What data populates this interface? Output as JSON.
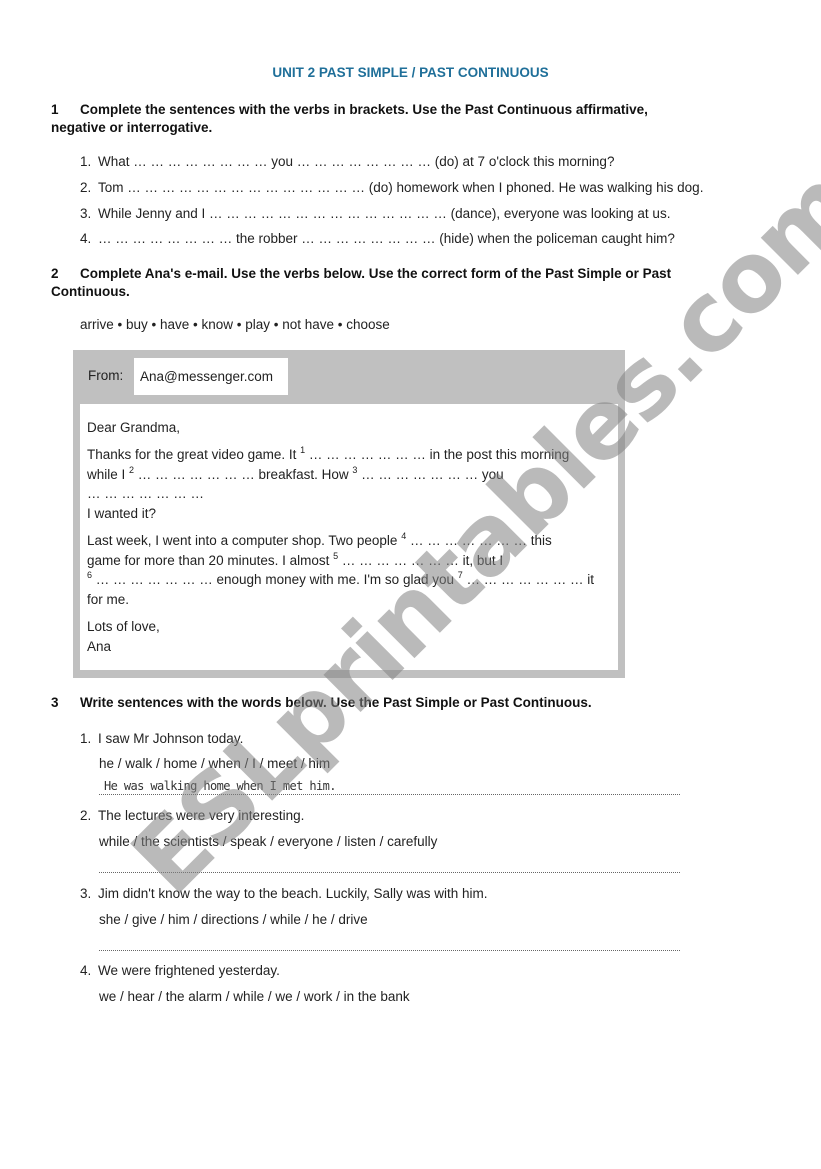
{
  "title": "UNIT 2 PAST SIMPLE / PAST CONTINUOUS",
  "section1": {
    "number": "1",
    "instruction_line1": "Complete the sentences with the verbs in brackets. Use the Past Continuous affirmative,",
    "instruction_line2": "negative or interrogative.",
    "items": [
      {
        "n": "1.",
        "text": "What … … … … … … … …  you … … … … … … … …  (do) at 7 o'clock this morning?"
      },
      {
        "n": "2.",
        "text": "Tom … … … … … … … … … … … … … …  (do) homework when I phoned. He was walking his dog."
      },
      {
        "n": "3.",
        "text": "While Jenny and I … … … … … … … … … … … … … …  (dance), everyone was looking at us."
      },
      {
        "n": "4.",
        "text": "… … … … … … … …  the robber … … … … … … … …  (hide) when the policeman caught him?"
      }
    ]
  },
  "section2": {
    "number": "2",
    "instruction_line1": "Complete Ana's e-mail. Use the verbs below. Use the correct form of the Past Simple or Past",
    "instruction_line2": "Continuous.",
    "word_bank": "arrive • buy • have • know • play • not have • choose",
    "email": {
      "from_label": "From:",
      "from_value": "Ana@messenger.com",
      "greeting": "Dear Grandma,",
      "p1_a": "Thanks for the great video game. It ",
      "sup1": "1",
      "p1_b": " … … … … … … …  in the post this morning",
      "p1_c": "while I ",
      "sup2": "2",
      "p1_d": " … … … … … … …  breakfast. How ",
      "sup3": "3",
      "p1_e": " … … … … … … …  you",
      "p1_f": "… … … … … … …",
      "p1_g": "I wanted it?",
      "p2_a": "Last week, I went into a computer shop. Two people ",
      "sup4": "4",
      "p2_b": " … … … … … … …  this",
      "p2_c": "game for more than 20 minutes. I almost ",
      "sup5": "5",
      "p2_d": " … … … … … … …  it, but I",
      "sup6": "6",
      "p2_e": " … … … … … … …  enough money with me. I'm so glad you ",
      "sup7": "7",
      "p2_f": " … … … … … … …  it",
      "p2_g": "for me.",
      "closing": "Lots of love,",
      "signature": "Ana"
    }
  },
  "section3": {
    "number": "3",
    "instruction": "Write sentences with the words below. Use the Past Simple or Past Continuous.",
    "items": [
      {
        "n": "1.",
        "context": "I saw Mr Johnson today.",
        "words": "he / walk / home / when / I / meet / him",
        "answer": "He was walking home when I met him."
      },
      {
        "n": "2.",
        "context": "The lectures were very interesting.",
        "words": "while / the scientists / speak / everyone / listen / carefully",
        "answer": ""
      },
      {
        "n": "3.",
        "context": "Jim didn't know the way to the beach. Luckily, Sally was with him.",
        "words": "she / give / him / directions / while / he / drive",
        "answer": ""
      },
      {
        "n": "4.",
        "context": "We were frightened yesterday.",
        "words": "we / hear / the alarm / while / we / work / in the bank",
        "answer": ""
      }
    ]
  },
  "watermark": "ESLprintables.com",
  "colors": {
    "title": "#1f6f99",
    "email_frame": "#c0c0c0"
  }
}
